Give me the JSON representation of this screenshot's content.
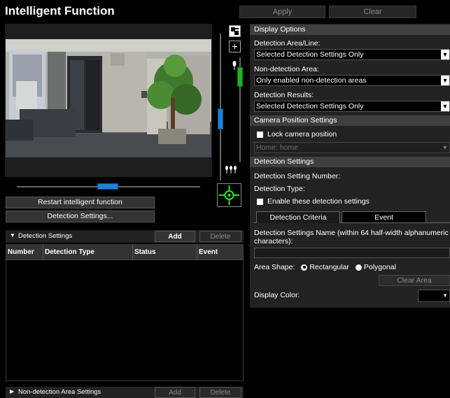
{
  "page_title": "Intelligent Function",
  "top_buttons": {
    "apply": "Apply",
    "clear": "Clear"
  },
  "left": {
    "restart_button": "Restart intelligent function",
    "detection_settings_button": "Detection Settings...",
    "detection_section": {
      "title": "Detection Settings",
      "add": "Add",
      "delete": "Delete",
      "columns": [
        "Number",
        "Detection Type",
        "Status",
        "Event"
      ]
    },
    "nondetection_section": {
      "title": "Non-detection Area Settings",
      "add": "Add",
      "delete": "Delete"
    }
  },
  "right": {
    "display_options": {
      "title": "Display Options",
      "area_line_label": "Detection Area/Line:",
      "area_line_value": "Selected Detection Settings Only",
      "nondetection_label": "Non-detection Area:",
      "nondetection_value": "Only enabled non-detection areas",
      "results_label": "Detection Results:",
      "results_value": "Selected Detection Settings Only"
    },
    "camera_position": {
      "title": "Camera Position Settings",
      "lock_label": "Lock camera position",
      "preset_value": "Home: home"
    },
    "detection_settings": {
      "title": "Detection Settings",
      "number_label": "Detection Setting Number:",
      "type_label": "Detection Type:",
      "enable_label": "Enable these detection settings",
      "tab_criteria": "Detection Criteria",
      "tab_event": "Event",
      "name_label": "Detection Settings Name (within 64 half-width alphanumeric characters):",
      "area_shape_label": "Area Shape:",
      "rectangular": "Rectangular",
      "polygonal": "Polygonal",
      "clear_area": "Clear Area",
      "display_color_label": "Display Color:"
    }
  }
}
